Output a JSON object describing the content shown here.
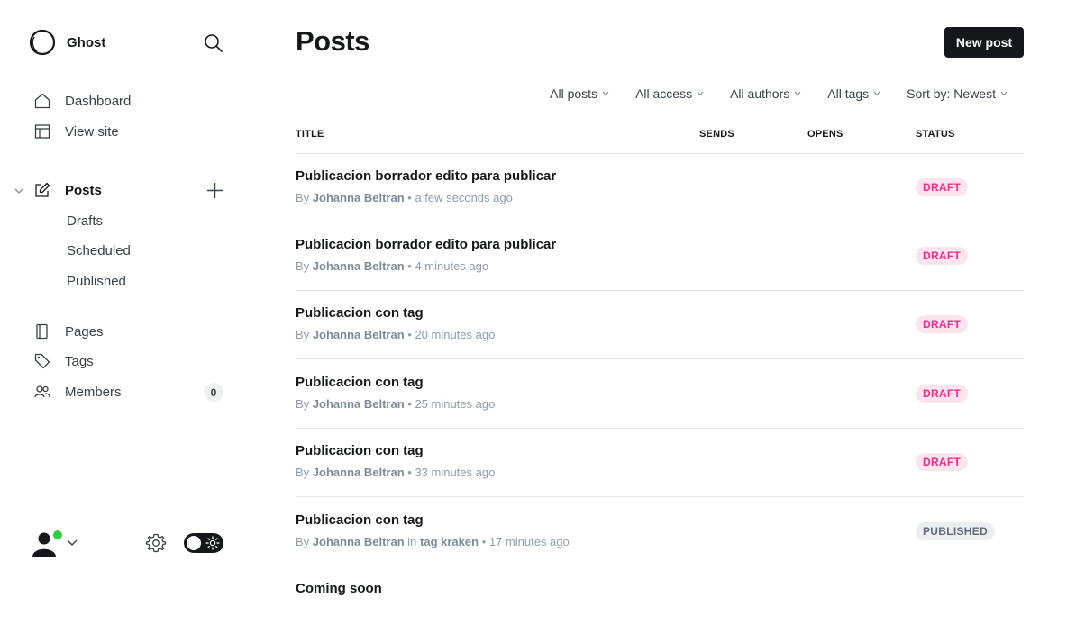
{
  "brand": {
    "name": "Ghost"
  },
  "nav": {
    "dashboard": "Dashboard",
    "view_site": "View site",
    "posts": "Posts",
    "drafts": "Drafts",
    "scheduled": "Scheduled",
    "published": "Published",
    "pages": "Pages",
    "tags": "Tags",
    "members": "Members",
    "members_count": "0"
  },
  "main": {
    "title": "Posts",
    "new_post_label": "New post",
    "filters": [
      "All posts",
      "All access",
      "All authors",
      "All tags",
      "Sort by: Newest"
    ],
    "columns": {
      "title": "TITLE",
      "sends": "SENDS",
      "opens": "OPENS",
      "status": "STATUS"
    },
    "posts": [
      {
        "title": "Publicacion borrador edito para publicar",
        "by": "By",
        "author": "Johanna Beltran",
        "in": "",
        "tag": "",
        "time": "a few seconds ago",
        "status": "DRAFT"
      },
      {
        "title": "Publicacion borrador edito para publicar",
        "by": "By",
        "author": "Johanna Beltran",
        "in": "",
        "tag": "",
        "time": "4 minutes ago",
        "status": "DRAFT"
      },
      {
        "title": "Publicacion con tag",
        "by": "By",
        "author": "Johanna Beltran",
        "in": "",
        "tag": "",
        "time": "20 minutes ago",
        "status": "DRAFT"
      },
      {
        "title": "Publicacion con tag",
        "by": "By",
        "author": "Johanna Beltran",
        "in": "",
        "tag": "",
        "time": "25 minutes ago",
        "status": "DRAFT"
      },
      {
        "title": "Publicacion con tag",
        "by": "By",
        "author": "Johanna Beltran",
        "in": "",
        "tag": "",
        "time": "33 minutes ago",
        "status": "DRAFT"
      },
      {
        "title": "Publicacion con tag",
        "by": "By",
        "author": "Johanna Beltran",
        "in": "in",
        "tag": "tag kraken",
        "time": "17 minutes ago",
        "status": "PUBLISHED"
      },
      {
        "title": "Coming soon",
        "by": "",
        "author": "",
        "in": "",
        "tag": "",
        "time": "",
        "status": ""
      }
    ]
  },
  "colors": {
    "accent": "#15171a",
    "draft": "#f22c8a",
    "online": "#30cf43"
  }
}
